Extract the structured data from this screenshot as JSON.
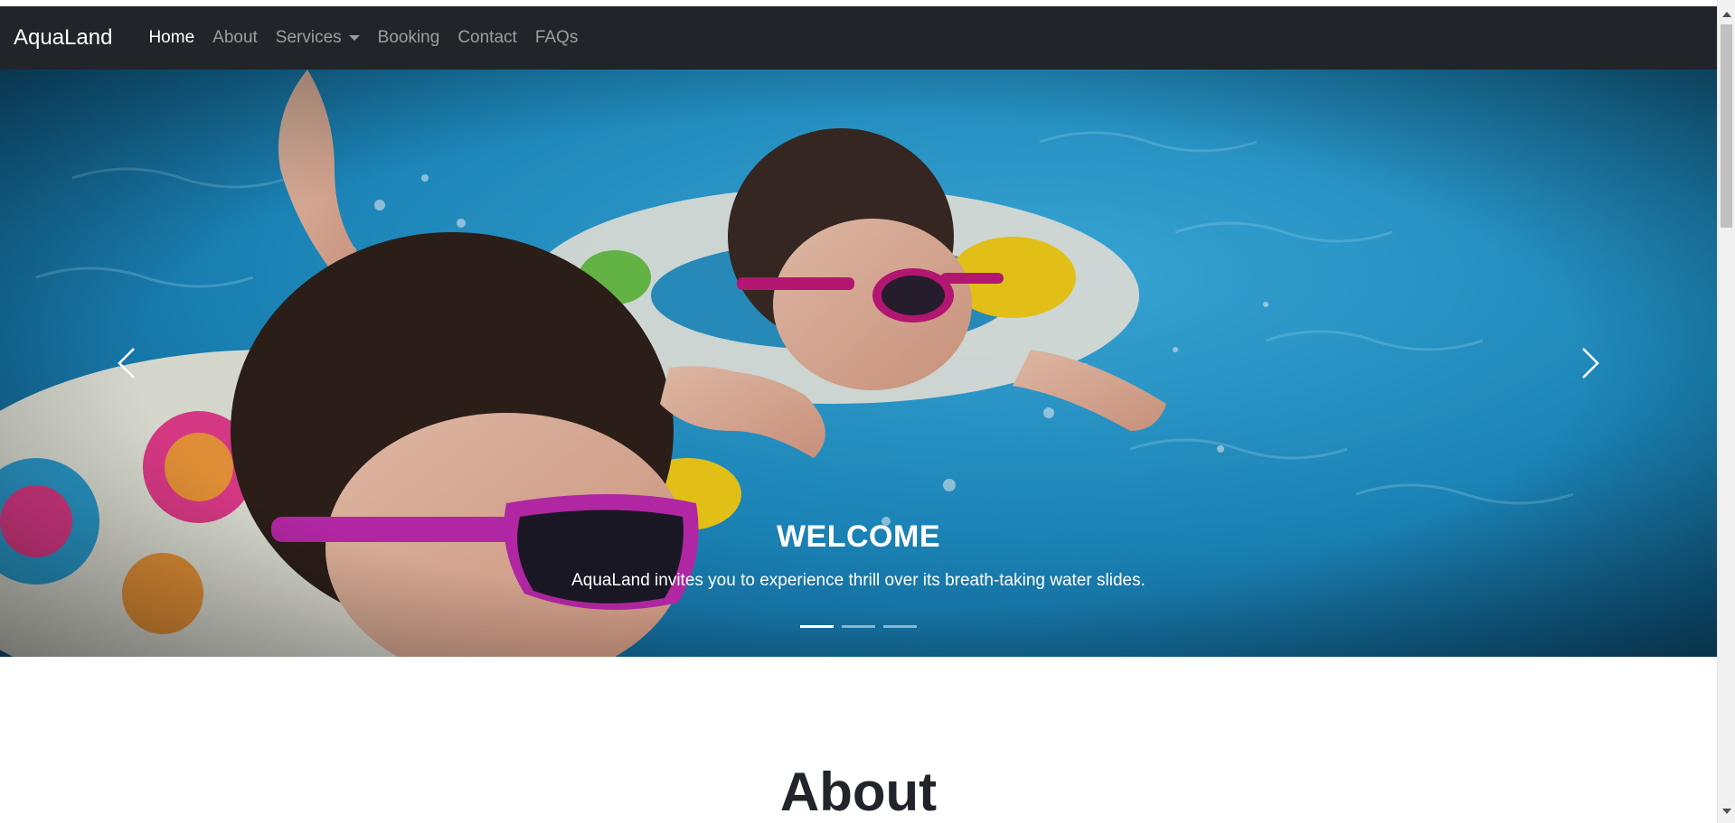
{
  "navbar": {
    "brand": "AquaLand",
    "items": [
      {
        "label": "Home",
        "active": true
      },
      {
        "label": "About"
      },
      {
        "label": "Services",
        "dropdown": true
      },
      {
        "label": "Booking"
      },
      {
        "label": "Contact"
      },
      {
        "label": "FAQs"
      }
    ]
  },
  "carousel": {
    "caption_title": "WELCOME",
    "caption_text": "AquaLand invites you to experience thrill over its breath-taking water slides.",
    "prev_icon": "chevron-left-icon",
    "next_icon": "chevron-right-icon",
    "slide_count": 3,
    "active_slide": 1
  },
  "about": {
    "title": "About"
  },
  "colors": {
    "navbar_bg": "#212529",
    "water": "#1f8cc0",
    "text_dark": "#212529"
  }
}
